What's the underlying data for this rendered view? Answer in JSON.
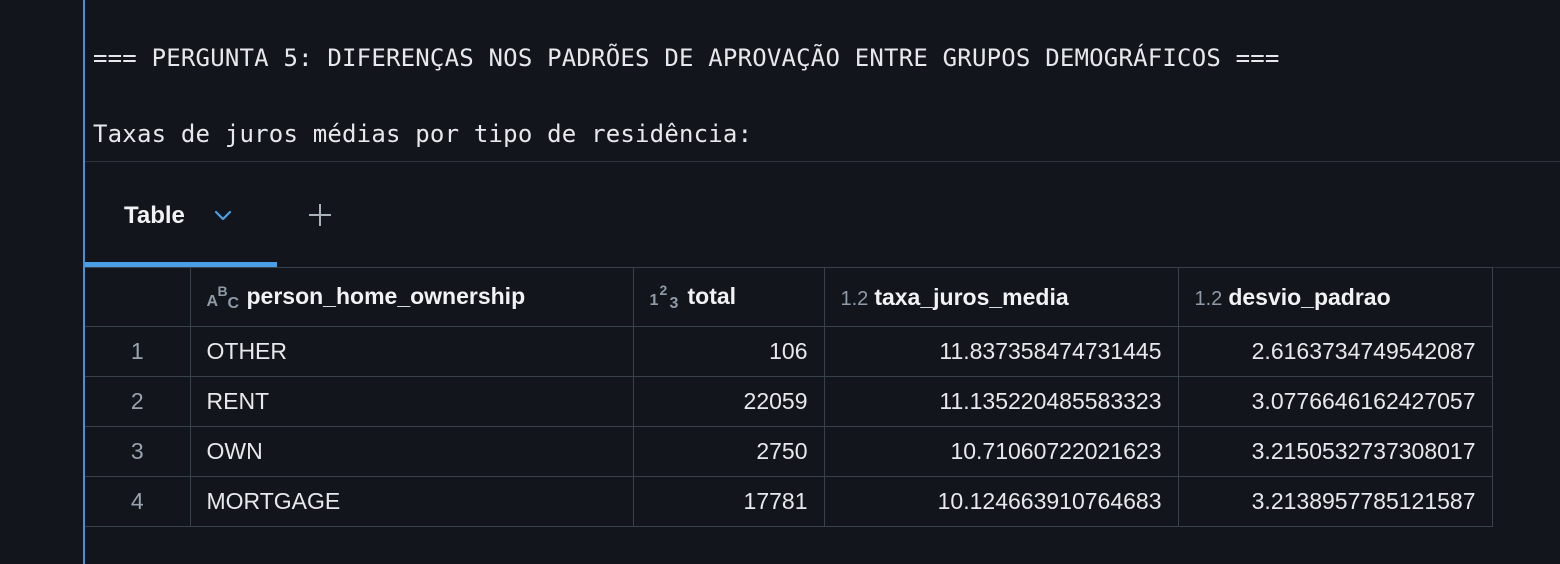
{
  "output": {
    "heading": "=== PERGUNTA 5: DIFERENÇAS NOS PADRÕES DE APROVAÇÃO ENTRE GRUPOS DEMOGRÁFICOS ===",
    "subheading": "Taxas de juros médias por tipo de residência:"
  },
  "tabs": {
    "active_label": "Table",
    "chevron_icon": "chevron-down-icon",
    "add_icon": "plus-icon"
  },
  "table": {
    "columns": [
      {
        "label": "person_home_ownership",
        "type_icon": "A B C",
        "type": "string"
      },
      {
        "label": "total",
        "type_icon": "1 2 3",
        "type": "integer"
      },
      {
        "label": "taxa_juros_media",
        "type_icon": "1.2",
        "type": "float"
      },
      {
        "label": "desvio_padrao",
        "type_icon": "1.2",
        "type": "float"
      }
    ],
    "rows": [
      {
        "index": "1",
        "person_home_ownership": "OTHER",
        "total": "106",
        "taxa_juros_media": "11.837358474731445",
        "desvio_padrao": "2.6163734749542087"
      },
      {
        "index": "2",
        "person_home_ownership": "RENT",
        "total": "22059",
        "taxa_juros_media": "11.135220485583323",
        "desvio_padrao": "3.0776646162427057"
      },
      {
        "index": "3",
        "person_home_ownership": "OWN",
        "total": "2750",
        "taxa_juros_media": "10.71060722021623",
        "desvio_padrao": "3.2150532737308017"
      },
      {
        "index": "4",
        "person_home_ownership": "MORTGAGE",
        "total": "17781",
        "taxa_juros_media": "10.124663910764683",
        "desvio_padrao": "3.2138957785121587"
      }
    ]
  },
  "colors": {
    "background": "#12161c",
    "accent": "#4a9ee6",
    "grid_border": "#39414b"
  }
}
